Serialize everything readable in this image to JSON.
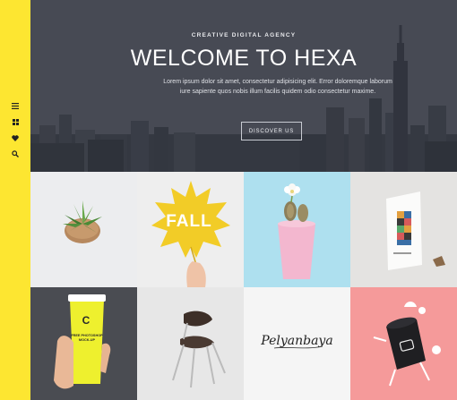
{
  "sidebar": {
    "icons": [
      {
        "name": "menu-icon"
      },
      {
        "name": "grid-icon"
      },
      {
        "name": "heart-icon"
      },
      {
        "name": "search-icon"
      }
    ],
    "accent": "#fde631"
  },
  "hero": {
    "tagline": "CREATIVE DIGITAL AGENCY",
    "title": "WELCOME TO HEXA",
    "text": "Lorem ipsum dolor sit amet, consectetur adipisicing elit. Error doloremque laborum iure sapiente quos nobis illum facilis quidem odio consectetur maxime.",
    "button_label": "DISCOVER US"
  },
  "portfolio": {
    "items": [
      {
        "name": "succulent-pot",
        "bg": "#ecedef"
      },
      {
        "name": "fall-leaf",
        "bg": "#eeeeee",
        "text": "FALL"
      },
      {
        "name": "cactus-pink-pot",
        "bg": "#aee0ef"
      },
      {
        "name": "poster-mockup",
        "bg": "#e4e3e1"
      },
      {
        "name": "coffee-cup-mockup",
        "bg": "#4a4c52",
        "letter": "C",
        "text": "FREE PHOTOSHOP MOCK-UP"
      },
      {
        "name": "chair",
        "bg": "#e7e7e7"
      },
      {
        "name": "signature-logo",
        "bg": "#f5f5f5",
        "text": "Pelyanbaya"
      },
      {
        "name": "black-cup-illustration",
        "bg": "#f59a9a"
      }
    ]
  }
}
